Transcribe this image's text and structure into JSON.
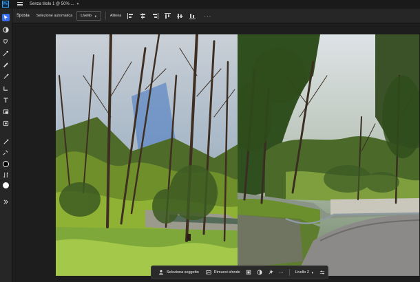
{
  "app": {
    "logo": "Ps",
    "document_title": "Senza titolo 1 @ 50% ..."
  },
  "options_bar": {
    "tool_label": "Sposta",
    "auto_select_label": "Selezione automatica",
    "auto_select_target": "Livello",
    "align_label": "Allinea",
    "more_label": "···"
  },
  "toolbar": {
    "icons": [
      "move-icon",
      "artboard-icon",
      "lasso-icon",
      "object-select-icon",
      "brush-icon",
      "eraser-icon",
      "gradient-icon",
      "type-icon",
      "shape-icon",
      "eyedropper-icon",
      "zoom-icon",
      "swap-icon",
      "expand-icon"
    ],
    "foreground_color": "#000000",
    "background_color": "#ffffff",
    "accent": "#3a6df0"
  },
  "contextual_taskbar": {
    "select_subject_label": "Seleziona soggetto",
    "remove_background_label": "Rimuovi sfondo",
    "more_label": "···",
    "layer_label": "Livello 2"
  }
}
